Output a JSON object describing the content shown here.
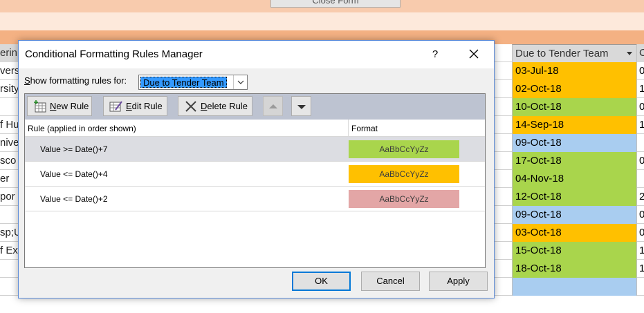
{
  "background": {
    "close_form_label": "Close Form",
    "left_header": "erin",
    "left_cells": [
      "vers",
      "rsity",
      "",
      "f Hu",
      "nive",
      "sco",
      "er",
      "por",
      "",
      "sp;U",
      "f Exe",
      "",
      ""
    ],
    "due_header": "Due to Tender Team",
    "right_header": "C",
    "rows": [
      {
        "date": "03-Jul-18",
        "color": "orange",
        "right": "0"
      },
      {
        "date": "02-Oct-18",
        "color": "orange",
        "right": "1"
      },
      {
        "date": "10-Oct-18",
        "color": "green",
        "right": "0"
      },
      {
        "date": "14-Sep-18",
        "color": "orange",
        "right": "1"
      },
      {
        "date": "09-Oct-18",
        "color": "blue",
        "right": ""
      },
      {
        "date": "17-Oct-18",
        "color": "green",
        "right": "0"
      },
      {
        "date": "04-Nov-18",
        "color": "green",
        "right": ""
      },
      {
        "date": "12-Oct-18",
        "color": "green",
        "right": "2"
      },
      {
        "date": "09-Oct-18",
        "color": "blue",
        "right": "0"
      },
      {
        "date": "03-Oct-18",
        "color": "orange",
        "right": "0"
      },
      {
        "date": "15-Oct-18",
        "color": "green",
        "right": "1"
      },
      {
        "date": "18-Oct-18",
        "color": "green",
        "right": "1"
      },
      {
        "date": "",
        "color": "blue",
        "right": ""
      }
    ],
    "colors": {
      "orange": "#ffc000",
      "green": "#a9d54c",
      "blue": "#a9cdf0"
    }
  },
  "dialog": {
    "title": "Conditional Formatting Rules Manager",
    "help_label": "?",
    "show_rules_label": "Show formatting rules for:",
    "show_rules_value": "Due to Tender Team",
    "toolbar": {
      "new_rule": "New Rule",
      "edit_rule": "Edit Rule",
      "delete_rule": "Delete Rule"
    },
    "columns": {
      "rule": "Rule (applied in order shown)",
      "format": "Format"
    },
    "rules": [
      {
        "condition": "Value >= Date()+7",
        "preview": "AaBbCcYyZz",
        "color": "#a9d54c",
        "selected": true
      },
      {
        "condition": "Value <= Date()+4",
        "preview": "AaBbCcYyZz",
        "color": "#ffc000",
        "selected": false
      },
      {
        "condition": "Value <= Date()+2",
        "preview": "AaBbCcYyZz",
        "color": "#e3a6a6",
        "selected": false
      }
    ],
    "buttons": {
      "ok": "OK",
      "cancel": "Cancel",
      "apply": "Apply"
    }
  }
}
